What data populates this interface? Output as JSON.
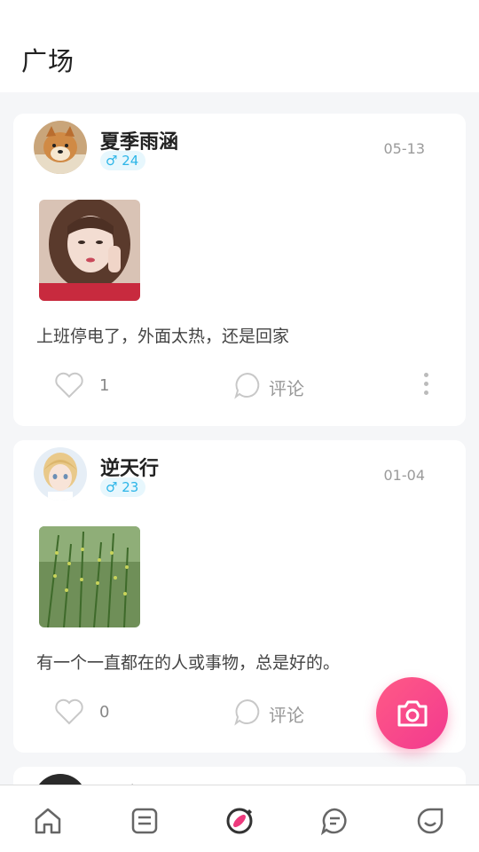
{
  "header": {
    "title": "广场"
  },
  "posts": [
    {
      "username": "夏季雨涵",
      "gender_age": "♂ 24",
      "date": "05-13",
      "text": "上班停电了，外面太热，还是回家",
      "likes": "1",
      "comment_label": "评论"
    },
    {
      "username": "逆天行",
      "gender_age": "♂ 23",
      "date": "01-04",
      "text": "有一个一直都在的人或事物，总是好的。",
      "likes": "0",
      "comment_label": "评论"
    },
    {
      "username": "王境"
    }
  ],
  "fab": {
    "icon": "camera-icon"
  },
  "nav": {
    "items": [
      {
        "icon": "home-icon"
      },
      {
        "icon": "notes-icon"
      },
      {
        "icon": "discover-icon",
        "active": true
      },
      {
        "icon": "chat-icon"
      },
      {
        "icon": "profile-smile-icon"
      }
    ]
  }
}
